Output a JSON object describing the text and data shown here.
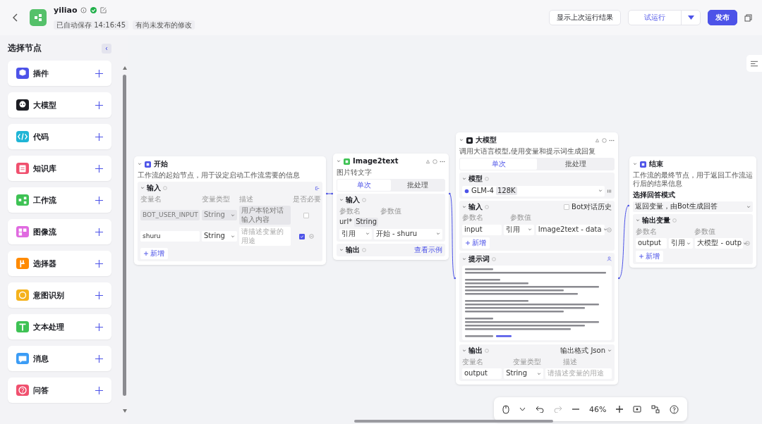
{
  "header": {
    "app_name": "yiliao",
    "saved": "已自动保存 14:16:45",
    "unpublished": "有尚未发布的修改",
    "buttons": {
      "last_result": "显示上次运行结果",
      "test_run": "试运行",
      "publish": "发布"
    }
  },
  "sidebar": {
    "title": "选择节点",
    "items": [
      {
        "label": "插件",
        "kind": "plugin",
        "color": "#4d53e8"
      },
      {
        "label": "大模型",
        "kind": "llm",
        "color": "#1c1d23"
      },
      {
        "label": "代码",
        "kind": "code",
        "color": "#1fb5d6"
      },
      {
        "label": "知识库",
        "kind": "knowledge",
        "color": "#f0506e"
      },
      {
        "label": "工作流",
        "kind": "workflow",
        "color": "#3ec254"
      },
      {
        "label": "图像流",
        "kind": "imageflow",
        "color": "#e06ae0"
      },
      {
        "label": "选择器",
        "kind": "selector",
        "color": "#ff8a00"
      },
      {
        "label": "意图识别",
        "kind": "intent",
        "color": "#f5b21b"
      },
      {
        "label": "文本处理",
        "kind": "text",
        "color": "#3ec254"
      },
      {
        "label": "消息",
        "kind": "message",
        "color": "#3b9cf5"
      },
      {
        "label": "问答",
        "kind": "qa",
        "color": "#f0506e"
      }
    ]
  },
  "nodes": [
    {
      "kind": "start",
      "title": "开始",
      "description": "工作流的起始节点，用于设定启动工作流需要的信息",
      "section": "输入",
      "columns": [
        "变量名",
        "变量类型",
        "描述",
        "是否必要"
      ],
      "rows": [
        {
          "name": "BOT_USER_INPUT",
          "type": "String",
          "description": "用户本轮对话输入内容",
          "required": false,
          "disabled": true
        },
        {
          "name": "shuru",
          "type": "String",
          "placeholder": "请描述变量的用途",
          "required": true,
          "disabled": false
        }
      ],
      "add": "新增"
    },
    {
      "kind": "image2text",
      "title": "Image2text",
      "description": "图片转文字",
      "tabs": [
        {
          "label": "单次",
          "selected": true
        },
        {
          "label": "批处理",
          "selected": false
        }
      ],
      "section": "输入",
      "columns": [
        "参数名",
        "参数值"
      ],
      "param": {
        "name": "url*",
        "type": "String",
        "mode": "引用",
        "value": "开始 - shuru"
      },
      "output": "输出",
      "example": "查看示例"
    },
    {
      "kind": "llm",
      "title": "大模型",
      "description": "调用大语言模型,使用变量和提示词生成回复",
      "tabs": [
        {
          "label": "单次",
          "selected": true
        },
        {
          "label": "批处理",
          "selected": false
        }
      ],
      "model_label": "模型",
      "model": "GLM-4",
      "model_tag": "128K",
      "section": "输入",
      "history": "Bot对话历史",
      "history_checked": false,
      "columns": [
        "参数名",
        "参数值"
      ],
      "param": {
        "name": "input",
        "mode": "引用",
        "value": "Image2text - data"
      },
      "add": "新增",
      "prompt_label": "提示词",
      "output_label": "输出",
      "format_label": "输出格式",
      "format": "Json",
      "out_columns": [
        "变量名",
        "变量类型",
        "描述"
      ],
      "out": {
        "name": "output",
        "type": "String",
        "placeholder": "请描述变量的用途"
      }
    },
    {
      "kind": "end",
      "title": "结束",
      "description": "工作流的最终节点，用于返回工作流运行后的结果信息",
      "mode_label": "选择回答模式",
      "mode": "返回变量，由Bot生成回答",
      "section": "输出变量",
      "columns": [
        "参数名",
        "参数值"
      ],
      "param": {
        "name": "output",
        "mode": "引用",
        "value": "大模型 - outp"
      },
      "add": "新增"
    }
  ],
  "toolbar": {
    "zoom": "46%"
  }
}
